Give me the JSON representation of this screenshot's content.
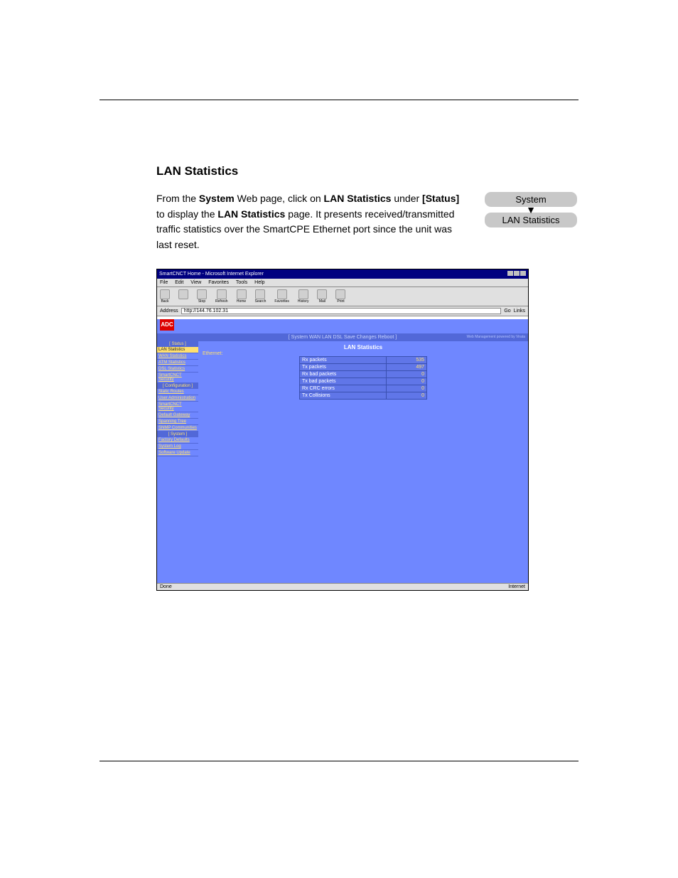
{
  "section_heading": "LAN Statistics",
  "paragraph": {
    "pre1": "From the ",
    "b1": "System",
    "mid1": " Web page, click on ",
    "b2": "LAN Statistics",
    "mid2": " under ",
    "b3": "[Status]",
    "mid3": " to display the ",
    "b4": "LAN Statistics",
    "mid4": " page. It presents received/transmitted traffic statistics over the SmartCPE Ethernet port since the unit was last reset."
  },
  "flow": {
    "top": "System",
    "bottom": "LAN Statistics"
  },
  "browser": {
    "title": "SmartCNCT Home - Microsoft Internet Explorer",
    "menu": [
      "File",
      "Edit",
      "View",
      "Favorites",
      "Tools",
      "Help"
    ],
    "toolbar": [
      "Back",
      "",
      "Stop",
      "Refresh",
      "Home",
      "Search",
      "Favorites",
      "History",
      "Mail",
      "Print"
    ],
    "address_label": "Address",
    "address_value": "http://144.76.102.31",
    "go": "Go",
    "links": "Links",
    "status_left": "Done",
    "status_right": "Internet"
  },
  "app": {
    "logo": "ADC",
    "tabs": "[ System  WAN  LAN  DSL  Save Changes  Reboot ]",
    "footer_note": "Web Management powered by Virata",
    "sidebar": {
      "group_status": "[ Status ]",
      "items_status": [
        "LAN Statistics",
        "WAN Statistics",
        "ATM Statistics",
        "DSL Statistics",
        "SmartCNCT Security"
      ],
      "group_config": "[ Configuration ]",
      "items_config": [
        "Static Routes",
        "User Administration",
        "SmartCNCT Security",
        "Default Gateway",
        "Spanning Tree",
        "SNMP Communities"
      ],
      "group_system": "[ System ]",
      "items_system": [
        "Factory Defaults",
        "System Log",
        "Software Update"
      ]
    },
    "pane": {
      "title": "LAN Statistics",
      "eth_label": "Ethernet:"
    }
  },
  "chart_data": {
    "type": "table",
    "title": "LAN Statistics",
    "rows": [
      {
        "label": "Rx packets",
        "value": 535
      },
      {
        "label": "Tx packets",
        "value": 497
      },
      {
        "label": "Rx bad packets",
        "value": 0
      },
      {
        "label": "Tx bad packets",
        "value": 0
      },
      {
        "label": "Rx CRC errors",
        "value": 0
      },
      {
        "label": "Tx Collisions",
        "value": 0
      }
    ]
  }
}
